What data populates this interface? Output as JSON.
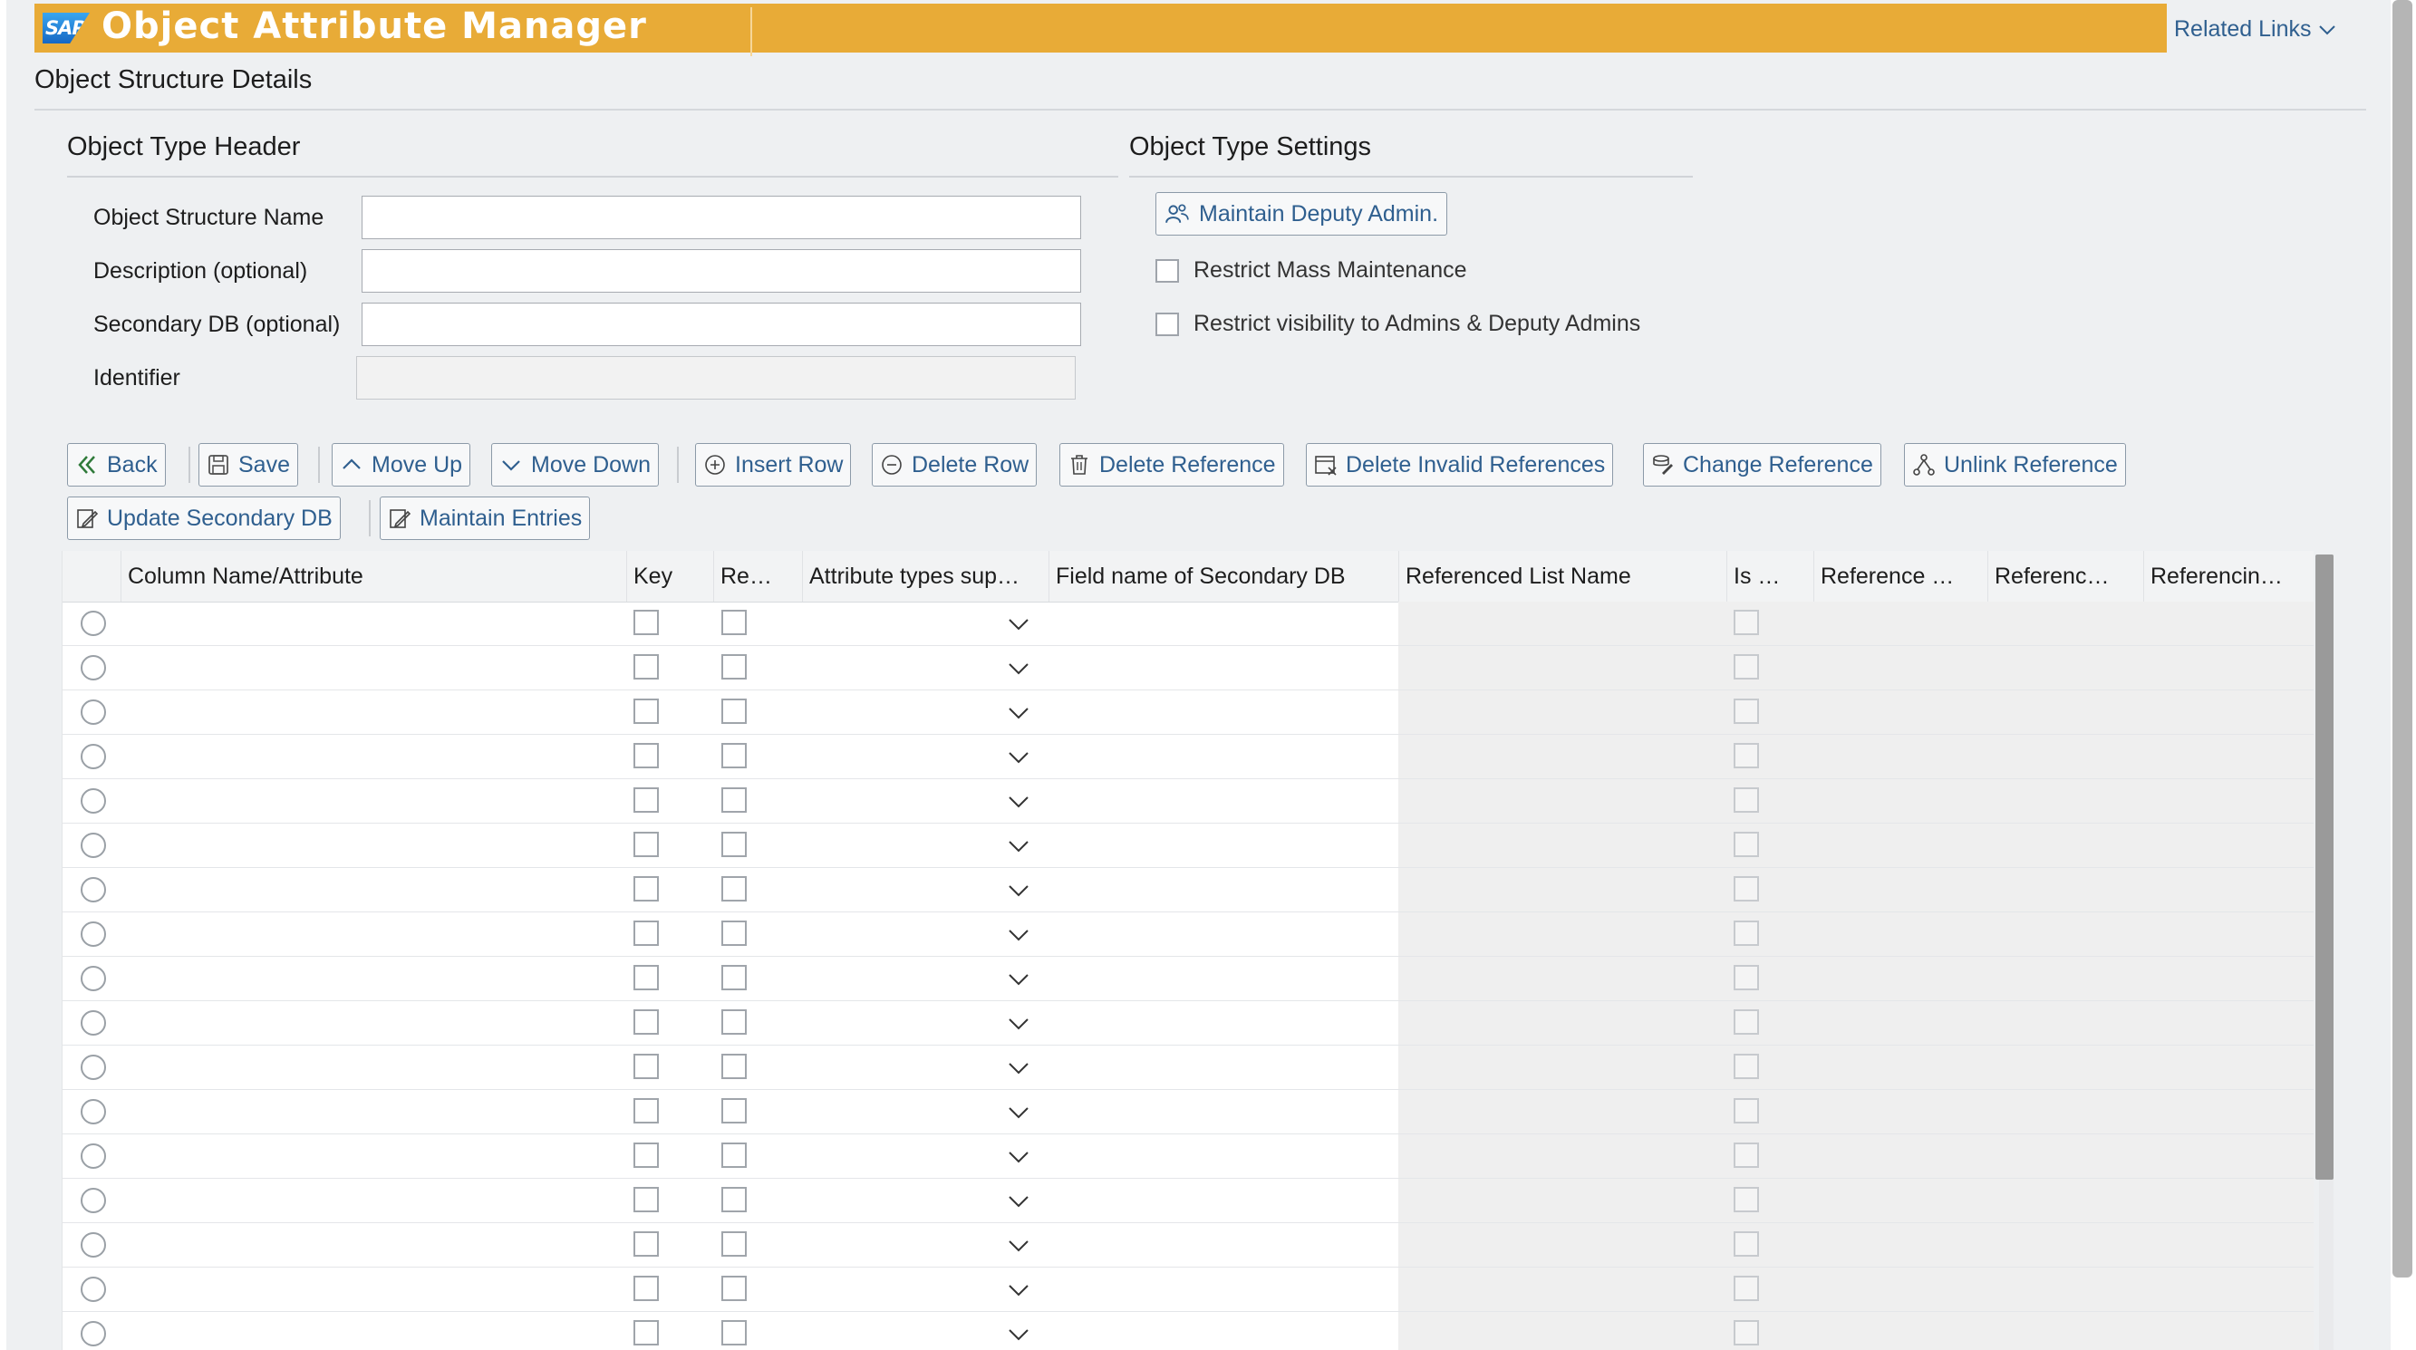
{
  "app": {
    "logo_text": "SAP",
    "title": "Object Attribute Manager",
    "related_links": "Related Links"
  },
  "page": {
    "heading": "Object Structure Details"
  },
  "header_section": {
    "title": "Object Type Header",
    "fields": {
      "name_label": "Object Structure Name",
      "name_value": "",
      "desc_label": "Description (optional)",
      "desc_value": "",
      "secdb_label": "Secondary DB (optional)",
      "secdb_value": "",
      "id_label": "Identifier",
      "id_value": ""
    }
  },
  "settings_section": {
    "title": "Object Type Settings",
    "deputy_button": "Maintain Deputy Admin.",
    "restrict_mass": "Restrict Mass Maintenance",
    "restrict_visibility": "Restrict visibility to Admins & Deputy Admins"
  },
  "toolbar": {
    "back": "Back",
    "save": "Save",
    "move_up": "Move Up",
    "move_down": "Move Down",
    "insert_row": "Insert Row",
    "delete_row": "Delete Row",
    "delete_reference": "Delete Reference",
    "delete_invalid": "Delete Invalid References",
    "change_reference": "Change Reference",
    "unlink_reference": "Unlink Reference",
    "update_secdb": "Update Secondary DB",
    "maintain_entries": "Maintain Entries"
  },
  "table": {
    "columns": {
      "c1": "Column Name/Attribute",
      "c2": "Key",
      "c3": "Re…",
      "c4": "Attribute types sup…",
      "c5": "Field name of Secondary DB",
      "c6": "Referenced List Name",
      "c7": "Is …",
      "c8": "Reference …",
      "c9": "Referenc…",
      "c10": "Referencin…"
    },
    "empty_rows": 17
  },
  "colors": {
    "title_bar": "#e8ab37",
    "accent_text": "#2f5f8f",
    "background": "#eef0f2"
  },
  "icons": [
    "back-double-chevron-icon",
    "save-icon",
    "chevron-up-icon",
    "chevron-down-icon",
    "add-circle-icon",
    "remove-circle-icon",
    "trash-icon",
    "delete-invalid-icon",
    "change-reference-icon",
    "unlink-icon",
    "update-icon",
    "edit-icon",
    "people-icon"
  ]
}
